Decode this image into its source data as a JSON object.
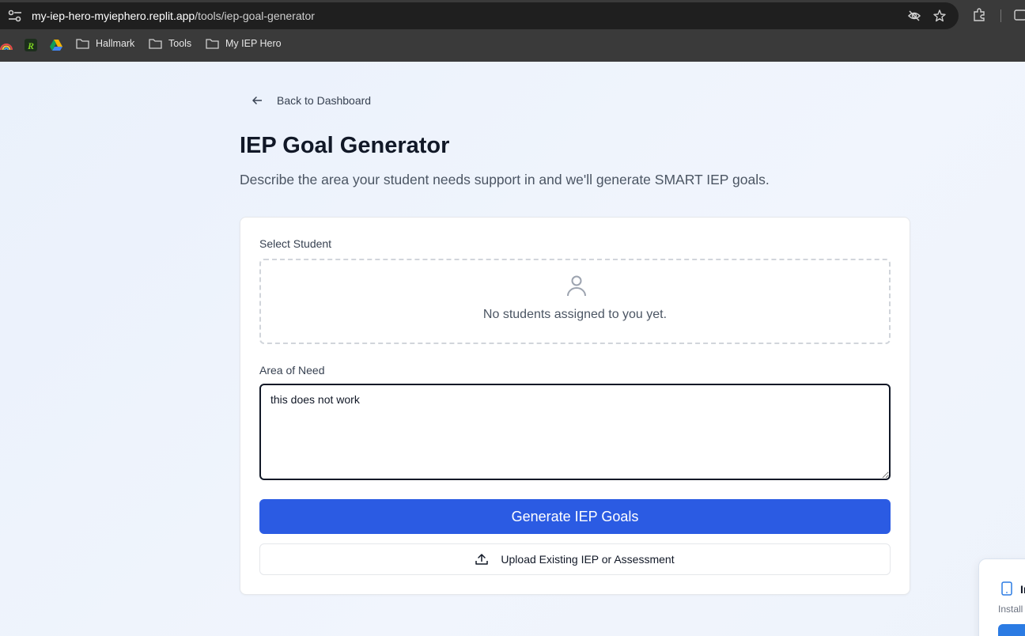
{
  "browser": {
    "url_host": "my-iep-hero-myiephero.replit.app",
    "url_path": "/tools/iep-goal-generator",
    "bookmarks": [
      "Hallmark",
      "Tools",
      "My IEP Hero"
    ]
  },
  "page": {
    "back_label": "Back to Dashboard",
    "title": "IEP Goal Generator",
    "subtitle": "Describe the area your student needs support in and we'll generate SMART IEP goals."
  },
  "form": {
    "student_label": "Select Student",
    "no_students_text": "No students assigned to you yet.",
    "area_label": "Area of Need",
    "area_value": "this does not work",
    "generate_label": "Generate IEP Goals",
    "upload_label": "Upload Existing IEP or Assessment"
  },
  "install_popup": {
    "title": "In",
    "subtitle": "Install"
  },
  "colors": {
    "primary": "#2b5be3",
    "page_bg": "#eef3fb",
    "title": "#111827"
  }
}
